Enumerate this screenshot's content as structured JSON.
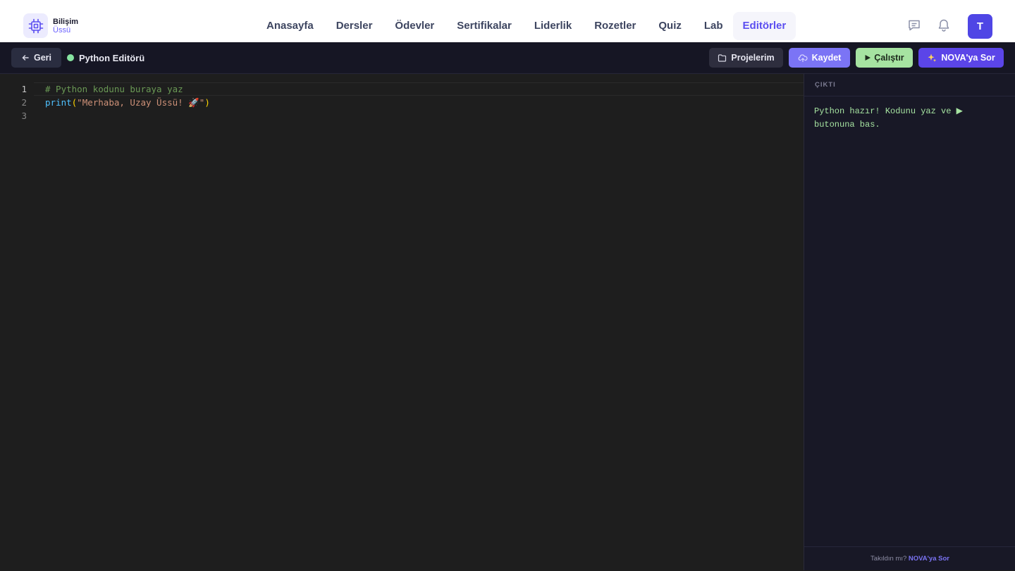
{
  "brand": {
    "title": "Bilişim",
    "subtitle": "Üssü"
  },
  "nav": {
    "items": [
      {
        "label": "Anasayfa"
      },
      {
        "label": "Dersler"
      },
      {
        "label": "Ödevler"
      },
      {
        "label": "Sertifikalar"
      },
      {
        "label": "Liderlik"
      },
      {
        "label": "Rozetler"
      },
      {
        "label": "Quiz"
      },
      {
        "label": "Lab"
      },
      {
        "label": "Editörler",
        "active": true
      }
    ],
    "icons": [
      "message-icon",
      "bell-icon"
    ],
    "avatar_initial": "T"
  },
  "toolbar": {
    "back_label": "Geri",
    "editor_title": "Python Editörü",
    "projects_label": "Projelerim",
    "save_label": "Kaydet",
    "run_label": "Çalıştır",
    "nova_label": "NOVA'ya Sor"
  },
  "editor": {
    "line_numbers": [
      "1",
      "2",
      "3"
    ],
    "line1_comment": "# Python kodunu buraya yaz",
    "line2_fn": "print",
    "line2_open": "(",
    "line2_string": "\"Merhaba, Uzay Üssü! 🚀\"",
    "line2_close": ")"
  },
  "output": {
    "header": "ÇIKTI",
    "message": "Python hazır! Kodunu yaz ve ▶ butonuna bas.",
    "footer_text": "Takıldın mı?",
    "footer_link": "NOVA'ya Sor"
  },
  "colors": {
    "accent": "#5b45e8",
    "run_green": "#a6e3a1",
    "status_dot": "#86e3a0",
    "toolbar_bg": "#161624",
    "editor_bg": "#1e1e1e"
  }
}
